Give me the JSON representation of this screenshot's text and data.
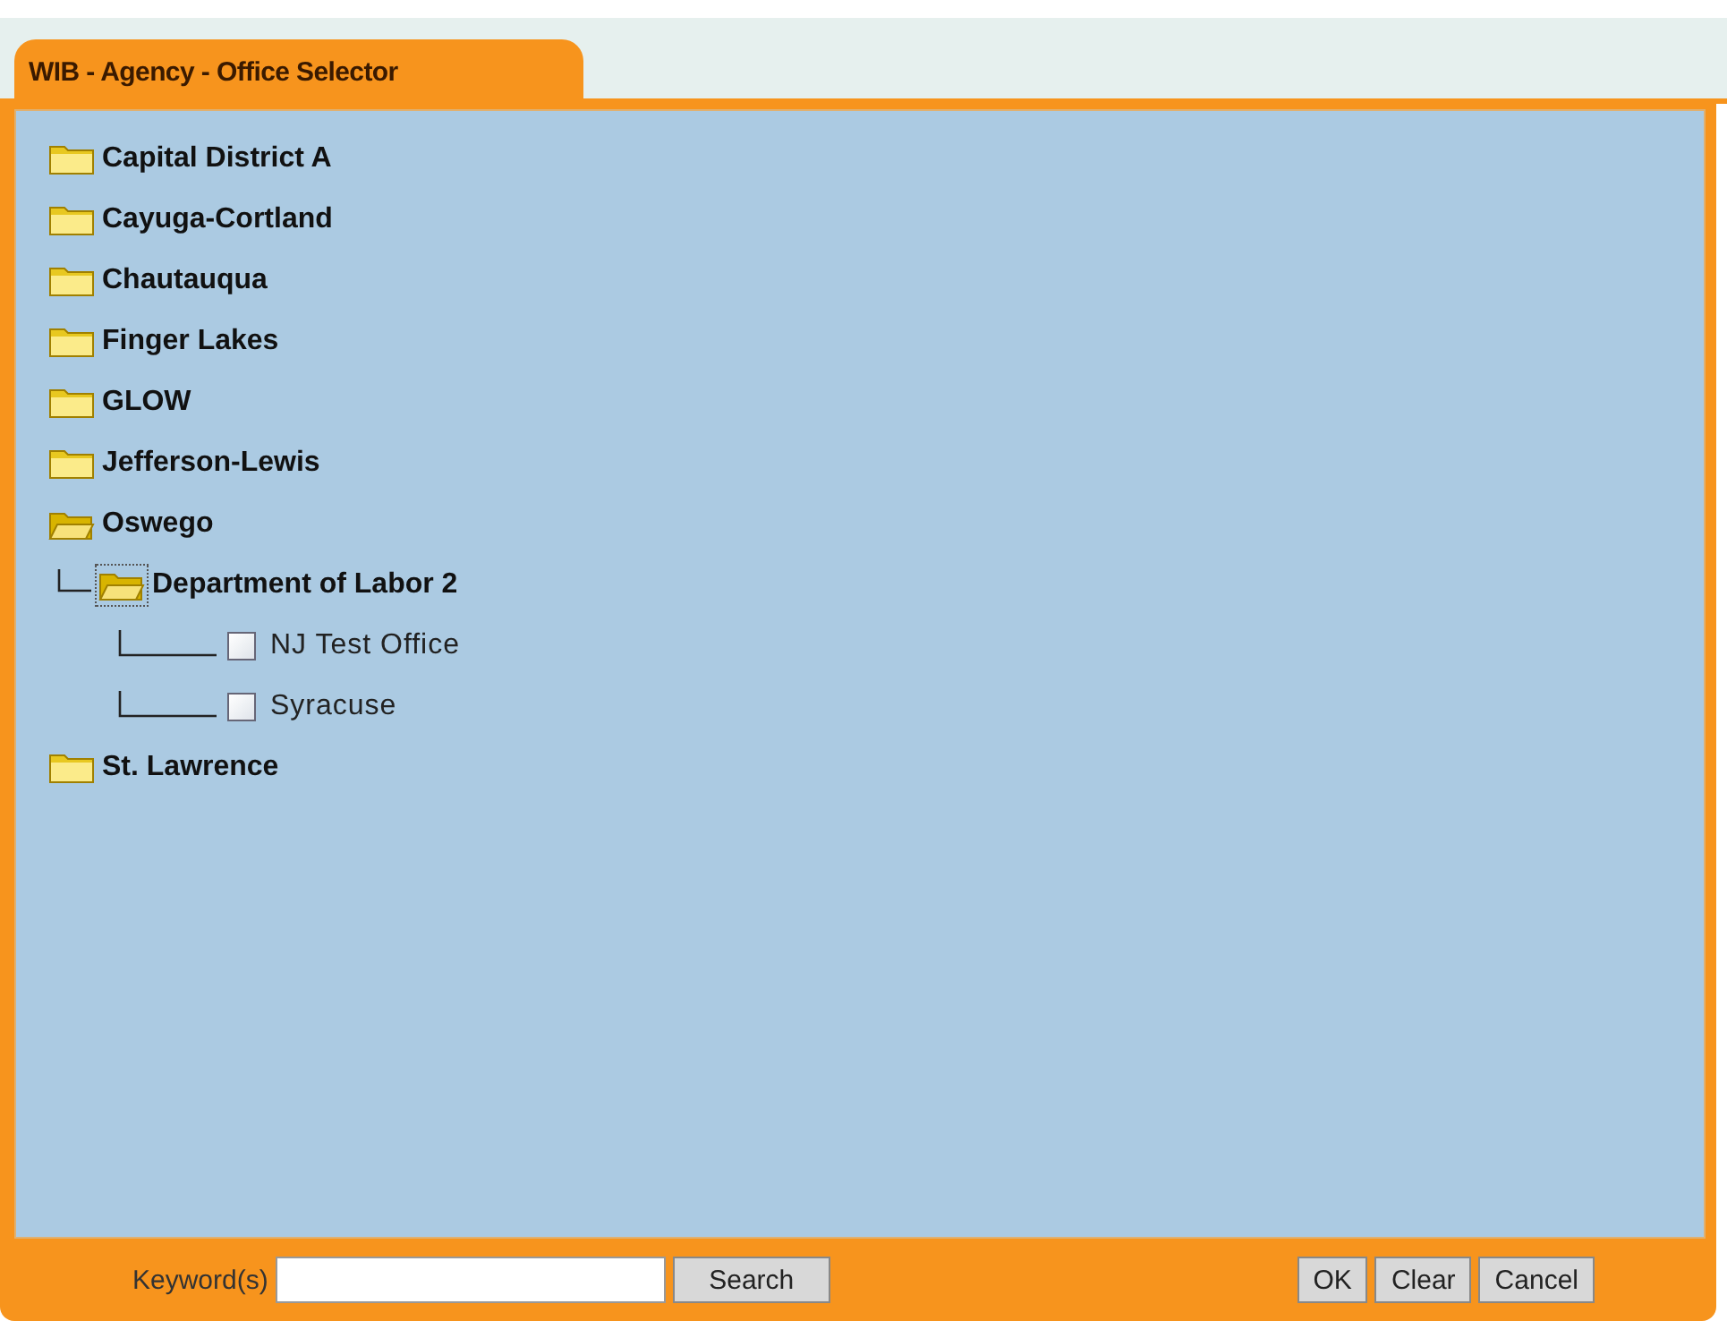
{
  "window": {
    "title": "WIB - Agency - Office Selector"
  },
  "tree": [
    {
      "kind": "folder",
      "label": "Capital District A",
      "expanded": false,
      "selected": false
    },
    {
      "kind": "folder",
      "label": "Cayuga-Cortland",
      "expanded": false,
      "selected": false
    },
    {
      "kind": "folder",
      "label": "Chautauqua",
      "expanded": false,
      "selected": false
    },
    {
      "kind": "folder",
      "label": "Finger Lakes",
      "expanded": false,
      "selected": false
    },
    {
      "kind": "folder",
      "label": "GLOW",
      "expanded": false,
      "selected": false
    },
    {
      "kind": "folder",
      "label": "Jefferson-Lewis",
      "expanded": false,
      "selected": false
    },
    {
      "kind": "folder",
      "label": "Oswego",
      "expanded": true,
      "selected": false,
      "children": [
        {
          "kind": "folder",
          "label": "Department of Labor 2",
          "expanded": true,
          "selected": true,
          "children": [
            {
              "kind": "office",
              "label": "NJ Test Office",
              "checked": false
            },
            {
              "kind": "office",
              "label": "Syracuse",
              "checked": false
            }
          ]
        }
      ]
    },
    {
      "kind": "folder",
      "label": "St. Lawrence",
      "expanded": false,
      "selected": false
    }
  ],
  "footer": {
    "keyword_label": "Keyword(s)",
    "search_button": "Search",
    "buttons": [
      "OK",
      "Clear",
      "Cancel"
    ]
  }
}
